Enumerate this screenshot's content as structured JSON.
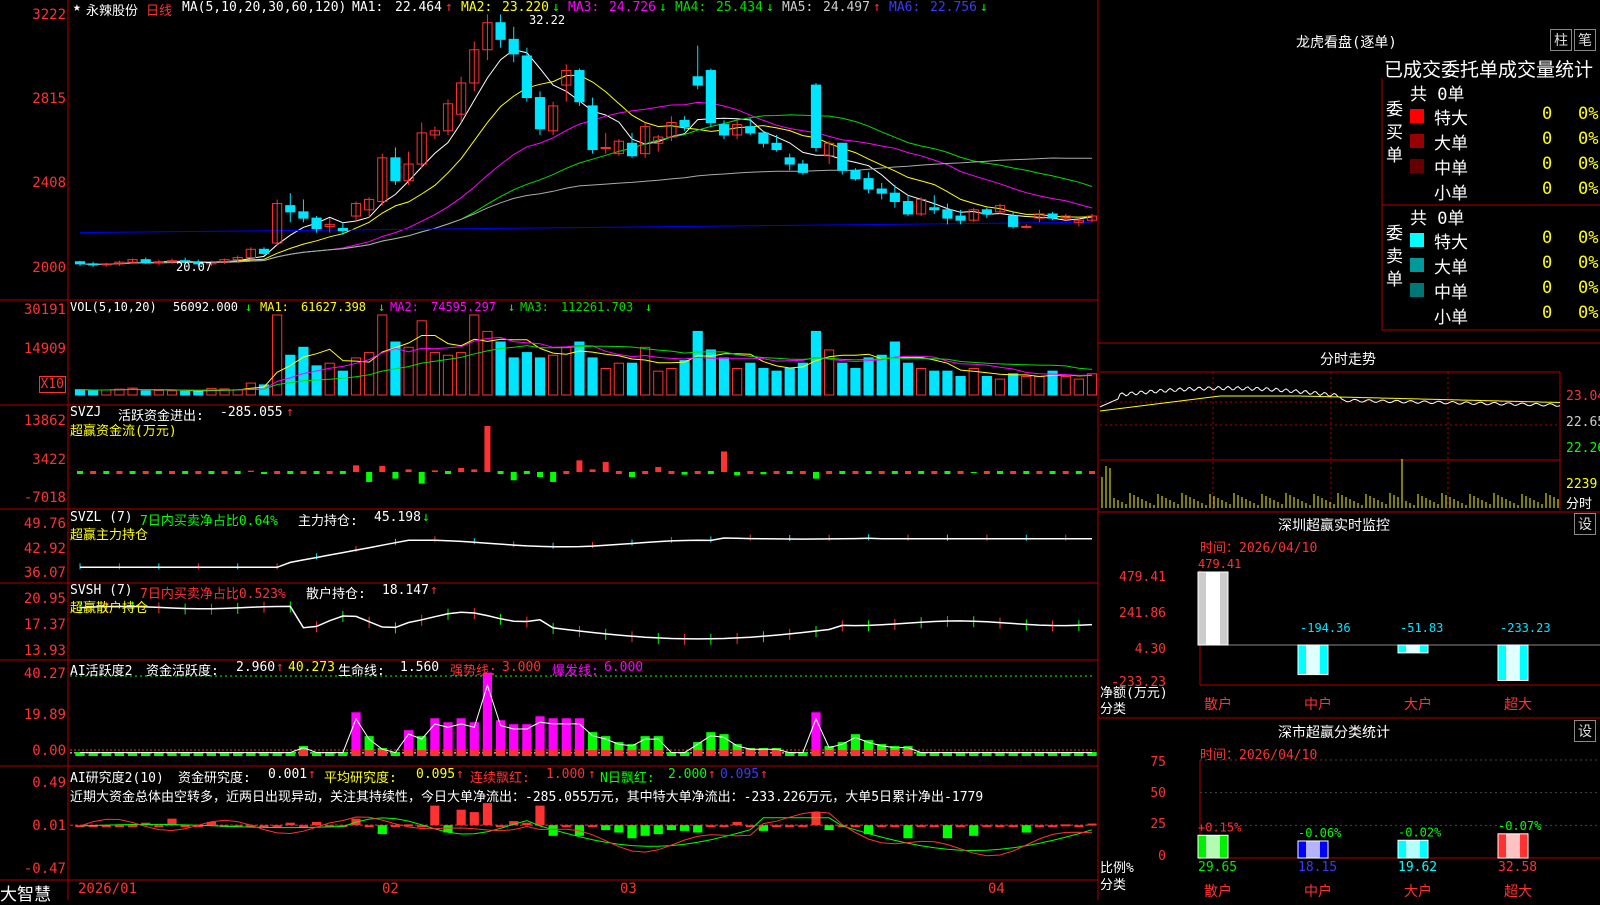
{
  "colors": {
    "up": "#ff3232",
    "down": "#00e5ff",
    "bg": "#000000",
    "frame": "#b00000",
    "ma1": "#ffffff",
    "ma2": "#ffff00",
    "ma3": "#ff00ff",
    "ma4": "#00dd00",
    "ma5": "#aaaaaa",
    "ma6": "#0000ff",
    "text": "#c8c8c8",
    "yellow": "#ffff00",
    "green": "#00ff00",
    "magenta": "#ff00ff"
  },
  "main": {
    "star": "★",
    "stock_name": "永辣股份",
    "period": "日线",
    "ma_params": "MA(5,10,20,30,60,120)",
    "ma": [
      {
        "label": "MA1:",
        "value": "22.464",
        "arrow": "↑"
      },
      {
        "label": "MA2:",
        "value": "23.220",
        "arrow": "↓"
      },
      {
        "label": "MA3:",
        "value": "24.726",
        "arrow": "↓"
      },
      {
        "label": "MA4:",
        "value": "25.434",
        "arrow": "↓"
      },
      {
        "label": "MA5:",
        "value": "24.497",
        "arrow": "↑"
      },
      {
        "label": "MA6:",
        "value": "22.756",
        "arrow": "↓"
      }
    ],
    "max_label": "32.22",
    "min_label": "20.07"
  },
  "price_axis": [
    "3222",
    "2815",
    "2408",
    "2000"
  ],
  "vol": {
    "title": "VOL(5,10,20)",
    "value": "56092.000",
    "arrow": "↓",
    "ma": [
      {
        "label": "MA1:",
        "value": "61627.398",
        "arrow": "↓"
      },
      {
        "label": "MA2:",
        "value": "74595.297",
        "arrow": "↓"
      },
      {
        "label": "MA3:",
        "value": "112261.703",
        "arrow": "↓"
      }
    ],
    "axis": [
      "30191",
      "14909"
    ],
    "unit": "X10"
  },
  "svzj": {
    "title": "SVZJ",
    "label": "活跃资金进出:",
    "value": "-285.055",
    "arrow": "↑",
    "sub": "超赢资金流(万元)",
    "axis": [
      "13862",
      "3422",
      "-7018"
    ]
  },
  "svzl": {
    "title": "SVZL (7)",
    "label1": "7日内买卖净占比0.64%",
    "label2": "主力持仓:",
    "value": "45.198",
    "arrow": "↓",
    "sub": "超赢主力持仓",
    "axis": [
      "49.76",
      "42.92",
      "36.07"
    ]
  },
  "svsh": {
    "title": "SVSH (7)",
    "label1": "7日内买卖净占比0.523%",
    "label2": "散户持仓:",
    "value": "18.147",
    "arrow": "↑",
    "sub": "超赢散户持仓",
    "axis": [
      "20.95",
      "17.37",
      "13.93"
    ]
  },
  "ai1": {
    "title": "AI活跃度2",
    "l1": "资金活跃度:",
    "v1": "2.960",
    "a1": "↑",
    "v1b": "40.273",
    "l2": "生命线:",
    "v2": "1.560",
    "l3": "强势线:",
    "v3": "3.000",
    "l4": "爆发线:",
    "v4": "6.000",
    "axis": [
      "40.27",
      "19.89",
      "0.00"
    ]
  },
  "ai2": {
    "title": "AI研究度2(10)",
    "l1": "资金研究度:",
    "v1": "0.001",
    "a1": "↑",
    "l2": "平均研究度:",
    "v2": "0.095",
    "a2": "↑",
    "l3": "连续飘红:",
    "v3": "1.000",
    "a3": "↑",
    "l4": "N日飘红:",
    "v4": "2.000",
    "a4": "↑",
    "v5": "0.095",
    "a5": "↑",
    "note": "近期大资金总体由空转多，近两日出现异动，关注其持续性，今日大单净流出：-285.055万元，其中特大单净流出：-233.226万元，大单5日累计净出-1779",
    "axis": [
      "0.49",
      "0.01",
      "-0.47"
    ]
  },
  "xaxis": {
    "brand": "大智慧",
    "dates": [
      "2026/01",
      "02",
      "03",
      "04"
    ]
  },
  "right": {
    "title": "龙虎看盘(逐单)",
    "btn1": "柱",
    "btn2": "笔",
    "header": "已成交委托单成交量统计",
    "buy": {
      "side": "委买单",
      "total": "共 0单",
      "rows": [
        {
          "name": "特大",
          "n": "0",
          "p": "0%",
          "color": "#ff0000"
        },
        {
          "name": "大单",
          "n": "0",
          "p": "0%",
          "color": "#990000"
        },
        {
          "name": "中单",
          "n": "0",
          "p": "0%",
          "color": "#660000"
        },
        {
          "name": "小单",
          "n": "0",
          "p": "0%",
          "color": ""
        }
      ]
    },
    "sell": {
      "side": "委卖单",
      "total": "共 0单",
      "rows": [
        {
          "name": "特大",
          "n": "0",
          "p": "0%",
          "color": "#00ffff"
        },
        {
          "name": "大单",
          "n": "0",
          "p": "0%",
          "color": "#009999"
        },
        {
          "name": "中单",
          "n": "0",
          "p": "0%",
          "color": "#007777"
        },
        {
          "name": "小单",
          "n": "0",
          "p": "0%",
          "color": ""
        }
      ]
    },
    "intraday": {
      "title": "分时走势",
      "axis": [
        "23.04",
        "22.65",
        "22.26",
        "2239"
      ],
      "xlabel": "分时"
    },
    "sz_monitor": {
      "title": "深圳超赢实时监控",
      "btn": "设",
      "time": "时间：2026/04/10",
      "axis": [
        "479.41",
        "241.86",
        "4.30",
        "-233.23"
      ],
      "ylabel": "净额(万元)",
      "xlabel": "分类",
      "bars": [
        {
          "name": "散户",
          "value": 479.41,
          "label": "479.41"
        },
        {
          "name": "中户",
          "value": -194.36,
          "label": "-194.36"
        },
        {
          "name": "大户",
          "value": -51.83,
          "label": "-51.83"
        },
        {
          "name": "超大",
          "value": -233.23,
          "label": "-233.23"
        }
      ]
    },
    "sz_class": {
      "title": "深市超赢分类统计",
      "btn": "设",
      "time": "时间：2026/04/10",
      "axis": [
        "75",
        "50",
        "25",
        "0"
      ],
      "ylabel": "比例%",
      "xlabel": "分类",
      "bars": [
        {
          "name": "散户",
          "value": 29.65,
          "delta": "+0.15%",
          "color": "#00ee00"
        },
        {
          "name": "中户",
          "value": 18.15,
          "delta": "-0.06%",
          "color": "#0000ff"
        },
        {
          "name": "大户",
          "value": 19.62,
          "delta": "-0.02%",
          "color": "#00ffff"
        },
        {
          "name": "超大",
          "value": 32.58,
          "delta": "-0.07%",
          "color": "#ff3232"
        }
      ]
    }
  },
  "chart_data": [
    {
      "type": "candlestick",
      "title": "永辣股份 日线",
      "ohlc": [
        [
          20.3,
          20.35,
          20.1,
          20.2
        ],
        [
          20.2,
          20.3,
          20.05,
          20.15
        ],
        [
          20.15,
          20.25,
          20.07,
          20.2
        ],
        [
          20.2,
          20.35,
          20.1,
          20.28
        ],
        [
          20.28,
          20.45,
          20.2,
          20.4
        ],
        [
          20.4,
          20.5,
          20.2,
          20.25
        ],
        [
          20.25,
          20.4,
          20.15,
          20.3
        ],
        [
          20.3,
          20.45,
          20.2,
          20.35
        ],
        [
          20.35,
          20.5,
          20.25,
          20.3
        ],
        [
          20.3,
          20.4,
          20.1,
          20.2
        ],
        [
          20.2,
          20.35,
          20.1,
          20.3
        ],
        [
          20.3,
          20.45,
          20.2,
          20.4
        ],
        [
          20.4,
          20.6,
          20.3,
          20.5
        ],
        [
          20.5,
          21.0,
          20.4,
          20.9
        ],
        [
          20.9,
          21.0,
          20.6,
          20.7
        ],
        [
          21.2,
          23.3,
          21.1,
          23.1
        ],
        [
          23.0,
          23.6,
          22.2,
          22.7
        ],
        [
          22.7,
          23.3,
          22.2,
          22.4
        ],
        [
          22.4,
          22.5,
          21.7,
          21.9
        ],
        [
          22.0,
          22.4,
          21.7,
          22.1
        ],
        [
          21.9,
          22.2,
          21.6,
          21.8
        ],
        [
          22.5,
          23.2,
          22.2,
          23.1
        ],
        [
          22.8,
          23.4,
          22.4,
          23.3
        ],
        [
          23.2,
          25.5,
          23.0,
          25.3
        ],
        [
          25.3,
          25.8,
          24.0,
          24.2
        ],
        [
          24.2,
          25.6,
          24.0,
          25.0
        ],
        [
          25.0,
          27.0,
          24.8,
          26.5
        ],
        [
          26.4,
          26.8,
          26.2,
          26.6
        ],
        [
          26.6,
          28.1,
          26.4,
          27.9
        ],
        [
          27.4,
          29.2,
          27.0,
          28.9
        ],
        [
          28.9,
          30.9,
          28.5,
          30.5
        ],
        [
          30.5,
          32.2,
          30.0,
          31.8
        ],
        [
          31.8,
          32.2,
          30.6,
          31.0
        ],
        [
          31.0,
          31.6,
          29.9,
          30.3
        ],
        [
          30.2,
          30.6,
          28.0,
          28.2
        ],
        [
          28.2,
          28.5,
          26.4,
          26.7
        ],
        [
          26.6,
          28.0,
          26.4,
          27.8
        ],
        [
          28.8,
          29.8,
          28.0,
          29.5
        ],
        [
          29.5,
          29.6,
          27.8,
          28.0
        ],
        [
          27.8,
          28.2,
          25.5,
          25.7
        ],
        [
          25.8,
          26.5,
          25.5,
          25.8
        ],
        [
          25.5,
          26.2,
          25.4,
          26.1
        ],
        [
          26.0,
          26.5,
          25.3,
          25.4
        ],
        [
          25.5,
          27.0,
          25.3,
          26.8
        ],
        [
          26.0,
          26.4,
          25.6,
          26.3
        ],
        [
          26.3,
          27.3,
          26.1,
          27.0
        ],
        [
          27.1,
          27.3,
          26.6,
          26.8
        ],
        [
          29.2,
          30.7,
          28.6,
          28.8
        ],
        [
          29.5,
          29.6,
          26.8,
          27.0
        ],
        [
          26.9,
          27.1,
          26.2,
          26.4
        ],
        [
          26.4,
          27.1,
          26.2,
          26.9
        ],
        [
          26.8,
          27.2,
          26.4,
          26.5
        ],
        [
          26.5,
          26.6,
          25.8,
          26.0
        ],
        [
          26.0,
          26.4,
          25.6,
          25.7
        ],
        [
          25.3,
          25.5,
          24.7,
          25.0
        ],
        [
          25.0,
          25.2,
          24.5,
          24.6
        ],
        [
          28.8,
          28.9,
          25.6,
          25.8
        ],
        [
          25.4,
          26.1,
          25.0,
          26.0
        ],
        [
          26.0,
          26.0,
          24.5,
          24.7
        ],
        [
          24.7,
          24.8,
          24.2,
          24.3
        ],
        [
          24.3,
          24.6,
          23.6,
          23.8
        ],
        [
          23.8,
          24.1,
          23.3,
          23.6
        ],
        [
          23.6,
          24.0,
          22.9,
          23.2
        ],
        [
          23.2,
          23.5,
          22.5,
          22.6
        ],
        [
          22.6,
          23.4,
          22.5,
          23.3
        ],
        [
          22.9,
          23.5,
          22.6,
          22.8
        ],
        [
          22.8,
          23.1,
          22.1,
          22.4
        ],
        [
          22.5,
          22.8,
          22.1,
          22.3
        ],
        [
          22.3,
          22.9,
          22.2,
          22.8
        ],
        [
          22.8,
          22.9,
          22.4,
          22.6
        ],
        [
          22.7,
          23.1,
          22.6,
          23.0
        ],
        [
          22.5,
          22.7,
          21.9,
          22.0
        ],
        [
          22.0,
          22.1,
          21.9,
          22.0
        ],
        [
          22.4,
          22.8,
          22.2,
          22.6
        ],
        [
          22.6,
          22.7,
          22.3,
          22.4
        ],
        [
          22.4,
          22.6,
          22.3,
          22.5
        ],
        [
          22.2,
          22.4,
          22.0,
          22.3
        ],
        [
          22.3,
          22.6,
          22.2,
          22.5
        ]
      ],
      "x_ticks": [
        "2026/01",
        "02",
        "03",
        "04"
      ],
      "y_ticks": [
        "3222",
        "2815",
        "2408",
        "2000"
      ]
    },
    {
      "type": "bar",
      "title": "VOL(5,10,20)",
      "values": [
        2000,
        1800,
        1900,
        2200,
        2600,
        1500,
        1700,
        1600,
        1400,
        1300,
        2500,
        2300,
        2000,
        4500,
        3800,
        30191,
        15000,
        18000,
        11000,
        12000,
        9000,
        14000,
        16000,
        30191,
        20000,
        18000,
        28000,
        16000,
        15000,
        16000,
        30191,
        24000,
        20000,
        14000,
        16000,
        14000,
        15000,
        18000,
        20000,
        14000,
        10000,
        12000,
        12000,
        18000,
        9000,
        10000,
        13000,
        24000,
        17000,
        14000,
        10000,
        12000,
        10000,
        9000,
        10000,
        12000,
        24000,
        17000,
        12000,
        10000,
        14000,
        15000,
        20000,
        12000,
        10000,
        9000,
        9000,
        7000,
        10000,
        7000,
        6000,
        8000,
        7000,
        7000,
        9000,
        7000,
        6000,
        8000
      ]
    },
    {
      "type": "bar",
      "title": "SVZJ",
      "values": [
        0,
        0,
        0,
        0,
        0,
        0,
        0,
        0,
        0,
        0,
        0,
        0,
        0,
        400,
        -600,
        0,
        0,
        0,
        0,
        0,
        0,
        2000,
        -3000,
        1800,
        -2000,
        800,
        -3500,
        500,
        0,
        1200,
        800,
        13862,
        0,
        -2500,
        0,
        -1500,
        -3000,
        0,
        3500,
        800,
        3000,
        0,
        -1500,
        0,
        1500,
        0,
        -800,
        0,
        0,
        6200,
        -1000,
        0,
        -700,
        0,
        0,
        0,
        -2000,
        0,
        0,
        0,
        0,
        0,
        0,
        0,
        0,
        0,
        0,
        0,
        -300,
        0,
        0,
        0,
        0,
        0,
        0,
        0,
        0,
        0
      ]
    },
    {
      "type": "line",
      "title": "SVZL (7)",
      "ylim": [
        36.07,
        49.76
      ]
    },
    {
      "type": "line",
      "title": "SVSH (7)",
      "ylim": [
        13.93,
        20.95
      ]
    },
    {
      "type": "bar",
      "title": "AI活跃度2",
      "ylim": [
        0,
        40.27
      ]
    },
    {
      "type": "bar",
      "title": "AI研究度2(10)",
      "ylim": [
        -0.47,
        0.49
      ]
    },
    {
      "type": "bar",
      "title": "深圳超赢实时监控",
      "categories": [
        "散户",
        "中户",
        "大户",
        "超大"
      ],
      "values": [
        479.41,
        -194.36,
        -51.83,
        -233.23
      ]
    },
    {
      "type": "bar",
      "title": "深市超赢分类统计",
      "categories": [
        "散户",
        "中户",
        "大户",
        "超大"
      ],
      "values": [
        29.65,
        18.15,
        19.62,
        32.58
      ]
    }
  ]
}
